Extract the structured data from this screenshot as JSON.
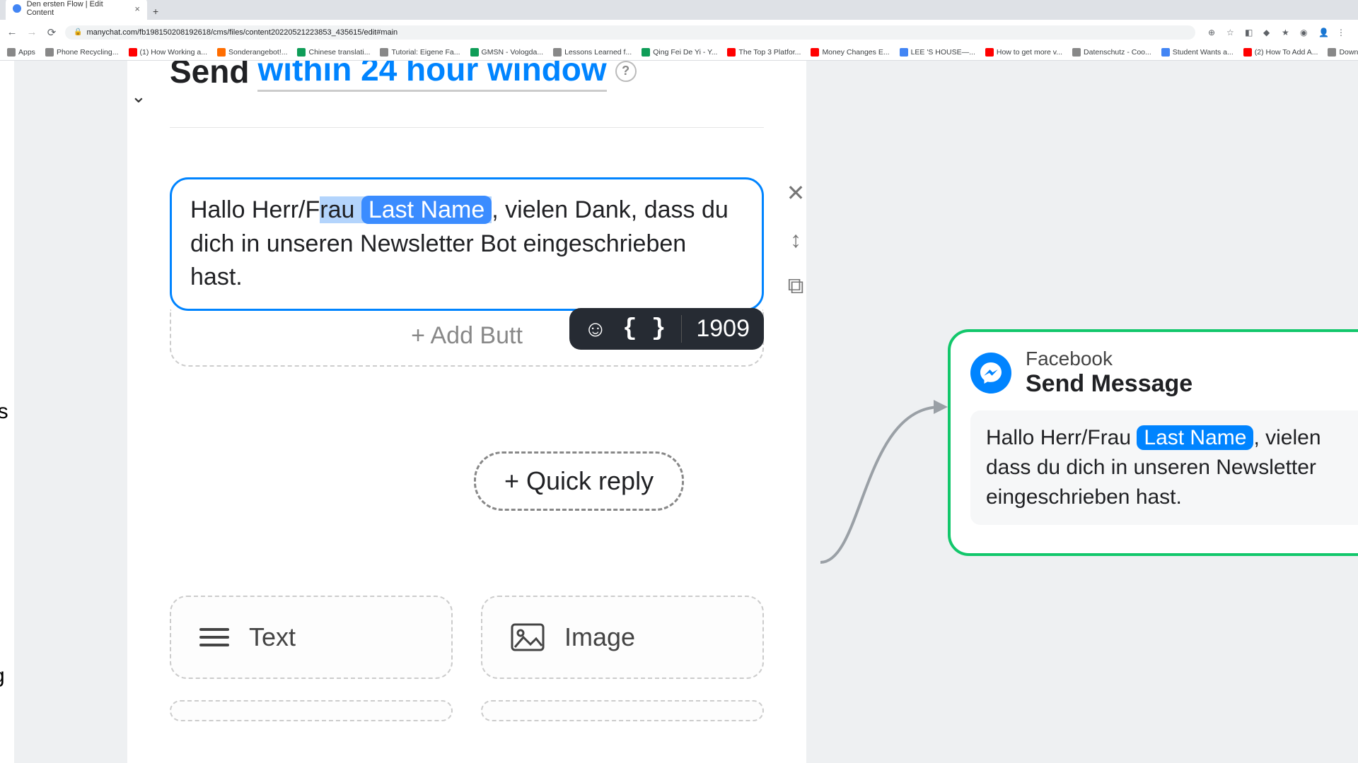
{
  "browser": {
    "tab_title": "Den ersten Flow | Edit Content",
    "url": "manychat.com/fb198150208192618/cms/files/content20220521223853_435615/edit#main",
    "bookmarks": [
      {
        "icon": "gr",
        "label": "Apps"
      },
      {
        "icon": "gr",
        "label": "Phone Recycling..."
      },
      {
        "icon": "r",
        "label": "(1) How Working a..."
      },
      {
        "icon": "o",
        "label": "Sonderangebot!..."
      },
      {
        "icon": "g",
        "label": "Chinese translati..."
      },
      {
        "icon": "gr",
        "label": "Tutorial: Eigene Fa..."
      },
      {
        "icon": "g",
        "label": "GMSN - Vologda..."
      },
      {
        "icon": "gr",
        "label": "Lessons Learned f..."
      },
      {
        "icon": "g",
        "label": "Qing Fei De Yi - Y..."
      },
      {
        "icon": "r",
        "label": "The Top 3 Platfor..."
      },
      {
        "icon": "r",
        "label": "Money Changes E..."
      },
      {
        "icon": "b",
        "label": "LEE 'S HOUSE—..."
      },
      {
        "icon": "r",
        "label": "How to get more v..."
      },
      {
        "icon": "gr",
        "label": "Datenschutz - Coo..."
      },
      {
        "icon": "b",
        "label": "Student Wants a..."
      },
      {
        "icon": "r",
        "label": "(2) How To Add A..."
      },
      {
        "icon": "gr",
        "label": "Download - Cooki..."
      }
    ]
  },
  "editor": {
    "send_prefix": "Send",
    "send_link": "within 24 hour window",
    "help": "?",
    "msg_before_var": "Hallo Herr/F",
    "msg_selected": "rau ",
    "var_label": "Last Name",
    "msg_after_var": ", vielen Dank, dass du dich in unseren Newsletter Bot eingeschrieben hast.",
    "add_button": "+ Add Butt",
    "char_counter": "1909",
    "quick_reply": "+ Quick reply",
    "card_text": "Text",
    "card_image": "Image"
  },
  "side_actions": {
    "close": "✕",
    "move": "↕",
    "copy": "⧉"
  },
  "flow_node": {
    "platform": "Facebook",
    "title": "Send Message",
    "msg_before": "Hallo Herr/Frau ",
    "var_label": "Last Name",
    "msg_after1": ", vielen",
    "msg_line2": "dass du dich in unseren Newsletter",
    "msg_line3": "eingeschrieben hast."
  },
  "left_stub": {
    "item1": "ls",
    "item2": "g"
  }
}
